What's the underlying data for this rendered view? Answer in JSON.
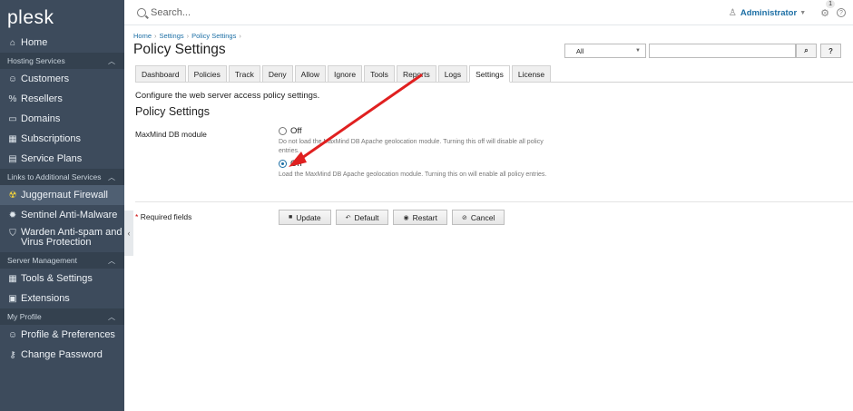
{
  "app": {
    "logo": "plesk"
  },
  "search": {
    "placeholder": "Search..."
  },
  "user": {
    "name": "Administrator",
    "notifications": "1"
  },
  "sidebar": {
    "home": "Home",
    "sec_hosting": "Hosting Services",
    "customers": "Customers",
    "resellers": "Resellers",
    "domains": "Domains",
    "subscriptions": "Subscriptions",
    "service_plans": "Service Plans",
    "sec_links": "Links to Additional Services",
    "juggernaut": "Juggernaut Firewall",
    "sentinel": "Sentinel Anti-Malware",
    "warden_1": "Warden Anti-spam and",
    "warden_2": "Virus Protection",
    "sec_server": "Server Management",
    "tools": "Tools & Settings",
    "extensions": "Extensions",
    "sec_profile": "My Profile",
    "profile": "Profile & Preferences",
    "change_password": "Change Password"
  },
  "breadcrumb": [
    "Home",
    "Settings",
    "Policy Settings"
  ],
  "page": {
    "title": "Policy Settings",
    "description": "Configure the web server access policy settings.",
    "section_title": "Policy Settings"
  },
  "filter": {
    "selected": "All",
    "search_btn": "⌕",
    "help_btn": "?"
  },
  "tabs": [
    "Dashboard",
    "Policies",
    "Track",
    "Deny",
    "Allow",
    "Ignore",
    "Tools",
    "Reports",
    "Logs",
    "Settings",
    "License"
  ],
  "active_tab": "Settings",
  "form": {
    "field_label": "MaxMind DB module",
    "off_label": "Off",
    "off_hint": "Do not load the MaxMind DB Apache geolocation module. Turning this off will disable all policy entries.",
    "on_label": "On",
    "on_hint": "Load the MaxMind DB Apache geolocation module. Turning this on will enable all policy entries.",
    "selected": "On",
    "required_label": "Required fields"
  },
  "buttons": {
    "update": "Update",
    "default": "Default",
    "restart": "Restart",
    "cancel": "Cancel"
  },
  "colors": {
    "sidebar": "#3d4b5c",
    "accent": "#1d6fa5",
    "annotation_arrow": "#e02020"
  }
}
